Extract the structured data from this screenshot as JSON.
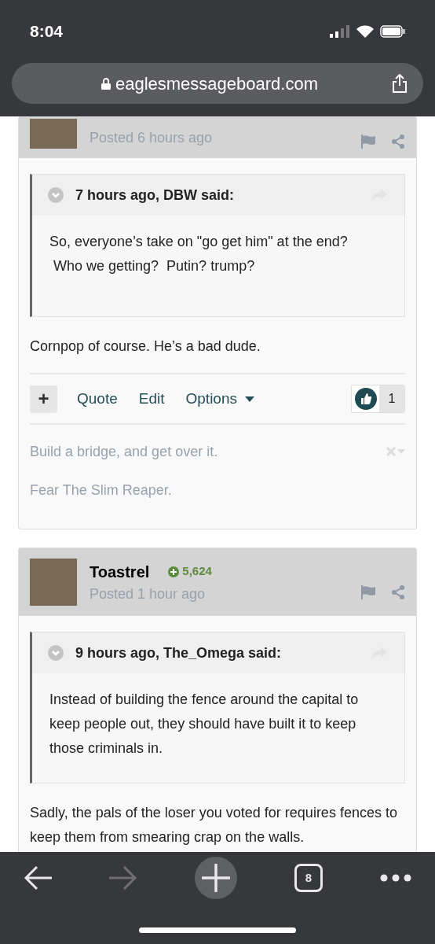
{
  "status_bar": {
    "time": "8:04"
  },
  "address_bar": {
    "url": "eaglesmessageboard.com"
  },
  "posts": [
    {
      "posted": "Posted 6 hours ago",
      "quote": {
        "header": "7 hours ago, DBW said:",
        "lines": [
          "So, everyone’s take on \"go get him\" at the end?",
          " Who we getting?  Putin? trump?"
        ]
      },
      "body": [
        "Cornpop of course. He’s a bad dude."
      ],
      "actions": {
        "plus": "+",
        "links": [
          "Quote",
          "Edit",
          "Options"
        ],
        "like_count": "1"
      },
      "signature": [
        "Build a bridge, and get over it.",
        "Fear The Slim Reaper."
      ]
    },
    {
      "author": "Toastrel",
      "reputation": "5,624",
      "posted": "Posted 1 hour ago",
      "quote": {
        "header": "9 hours ago, The_Omega said:",
        "lines": [
          "Instead of building the fence around the capital to keep people out, they should have built it to keep those criminals in."
        ]
      },
      "body": [
        "Sadly, the pals of the loser you voted for requires fences to keep them from smearing crap on the walls."
      ]
    }
  ],
  "toolbar": {
    "back_enabled": true,
    "forward_enabled": false,
    "tab_count": "8"
  }
}
